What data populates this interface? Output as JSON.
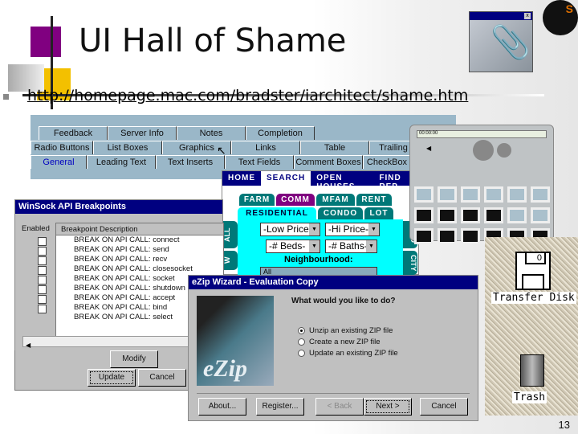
{
  "slide": {
    "title": "UI Hall of Shame",
    "url": "http://homepage.mac.com/bradster/iarchitect/shame.htm",
    "page_number": "13",
    "logo_letter": "S"
  },
  "tabs_dialog": {
    "rows": [
      [
        "Feedback",
        "Server Info",
        "Notes",
        "Completion"
      ],
      [
        "Radio Buttons",
        "List Boxes",
        "Graphics",
        "Links",
        "Table",
        "Trailing"
      ],
      [
        "General",
        "Leading Text",
        "Text Inserts",
        "Text Fields",
        "Comment Boxes",
        "CheckBox"
      ]
    ],
    "selected": "General"
  },
  "realestate": {
    "nav": [
      "HOME",
      "SEARCH",
      "OPEN HOUSES",
      "FIND REP"
    ],
    "nav_selected": "SEARCH",
    "cat_tabs_top": [
      "FARM",
      "COMM",
      "MFAM",
      "RENT"
    ],
    "cat_tabs_bottom": [
      "RESIDENTIAL",
      "CONDO",
      "LOT"
    ],
    "side_left": [
      "ALL",
      "W"
    ],
    "side_right": [
      "GEO",
      "CITY"
    ],
    "low_price": "-Low Price-",
    "hi_price": "-Hi Price-",
    "beds": "-# Beds-",
    "baths": "-# Baths-",
    "neighbourhood_label": "Neighbourhood:",
    "neighbourhood_value": "All"
  },
  "winsock": {
    "title": "WinSock API Breakpoints",
    "enabled_label": "Enabled",
    "column_header": "Breakpoint Description",
    "items": [
      "BREAK ON API CALL: connect",
      "BREAK ON API CALL: send",
      "BREAK ON API CALL: recv",
      "BREAK ON API CALL: closesocket",
      "BREAK ON API CALL: socket",
      "BREAK ON API CALL: shutdown",
      "BREAK ON API CALL: accept",
      "BREAK ON API CALL: bind",
      "BREAK ON API CALL: select"
    ],
    "modify": "Modify",
    "update": "Update",
    "cancel": "Cancel"
  },
  "ezip": {
    "title": "eZip Wizard - Evaluation Copy",
    "logo": "eZip",
    "question": "What would you like to do?",
    "options": [
      "Unzip an existing ZIP file",
      "Create a new ZIP file",
      "Update an existing ZIP file"
    ],
    "selected_index": 0,
    "buttons": {
      "about": "About...",
      "register": "Register...",
      "back": "< Back",
      "next": "Next >",
      "cancel": "Cancel"
    }
  },
  "player": {
    "time": "00:00:00"
  },
  "desktop": {
    "disk_label": "Transfer Disk",
    "disk_glyph": "0",
    "trash_label": "Trash"
  },
  "clippy": {
    "close": "x"
  }
}
